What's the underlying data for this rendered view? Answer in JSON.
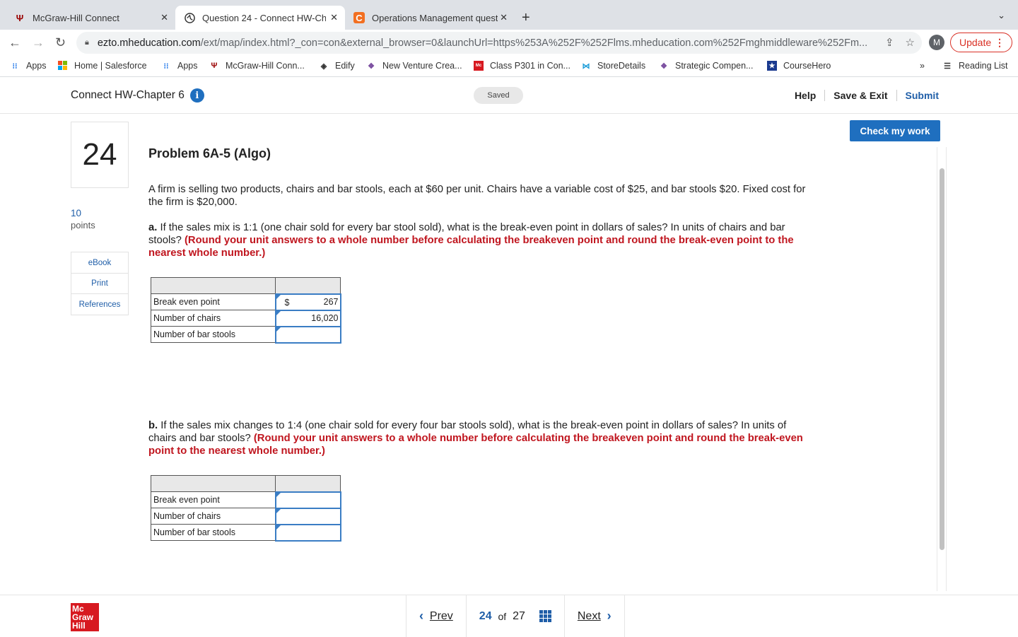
{
  "browser": {
    "tabs": [
      {
        "label": "McGraw-Hill Connect",
        "icon": "mcgraw-trident-icon"
      },
      {
        "label": "Question 24 - Connect HW-Ch",
        "icon": "globe-icon"
      },
      {
        "label": "Operations Management quest",
        "icon": "chegg-icon"
      }
    ],
    "url_host": "ezto.mheducation.com",
    "url_path": "/ext/map/index.html?_con=con&external_browser=0&launchUrl=https%253A%252F%252Flms.mheducation.com%252Fmghmiddleware%252Fm...",
    "avatar_letter": "M",
    "update_label": "Update",
    "bookmarks": [
      {
        "label": "Apps"
      },
      {
        "label": "Home | Salesforce"
      },
      {
        "label": "Apps"
      },
      {
        "label": "McGraw-Hill Conn..."
      },
      {
        "label": "Edify"
      },
      {
        "label": "New Venture Crea..."
      },
      {
        "label": "Class P301 in Con..."
      },
      {
        "label": "StoreDetails"
      },
      {
        "label": "Strategic Compen..."
      },
      {
        "label": "CourseHero"
      }
    ],
    "overflow_label": "»",
    "reading_list": "Reading List"
  },
  "header": {
    "title": "Connect HW-Chapter 6",
    "status": "Saved",
    "help": "Help",
    "save_exit": "Save & Exit",
    "submit": "Submit"
  },
  "question": {
    "number": "24",
    "points_value": "10",
    "points_label": "points",
    "rail": [
      "eBook",
      "Print",
      "References"
    ],
    "check_label": "Check my work",
    "title": "Problem 6A-5 (Algo)",
    "intro": "A firm is selling two products, chairs and bar stools, each at $60 per unit. Chairs have a variable cost of $25, and bar stools $20. Fixed cost for the firm is $20,000.",
    "part_a": {
      "prefix": "a.",
      "text": " If the sales mix is 1:1 (one chair sold for every bar stool sold), what is the break-even point in dollars of sales? In units of chairs and bar stools? ",
      "instruction": "(Round your unit answers to a whole number before calculating the breakeven point and round the break-even point to the nearest whole number.)"
    },
    "table_a": {
      "rows": [
        {
          "label": "Break even point",
          "currency": "$",
          "value": "267"
        },
        {
          "label": "Number of chairs",
          "currency": "",
          "value": "16,020"
        },
        {
          "label": "Number of bar stools",
          "currency": "",
          "value": ""
        }
      ]
    },
    "part_b": {
      "prefix": "b.",
      "text": " If the sales mix changes to 1:4 (one chair sold for every four bar stools sold), what is the break-even point in dollars of sales? In units of chairs and bar stools? ",
      "instruction": "(Round your unit answers to a whole number before calculating the breakeven point and round the break-even point to the nearest whole number.)"
    },
    "table_b": {
      "rows": [
        {
          "label": "Break even point",
          "value": ""
        },
        {
          "label": "Number of chairs",
          "value": ""
        },
        {
          "label": "Number of bar stools",
          "value": ""
        }
      ]
    }
  },
  "footer": {
    "logo_lines": [
      "Mc",
      "Graw",
      "Hill"
    ],
    "prev": "Prev",
    "current": "24",
    "of": "of",
    "total": "27",
    "next": "Next"
  },
  "colors": {
    "accent": "#1f6fbf",
    "instruction_red": "#c0161f",
    "logo_red": "#d71920"
  }
}
